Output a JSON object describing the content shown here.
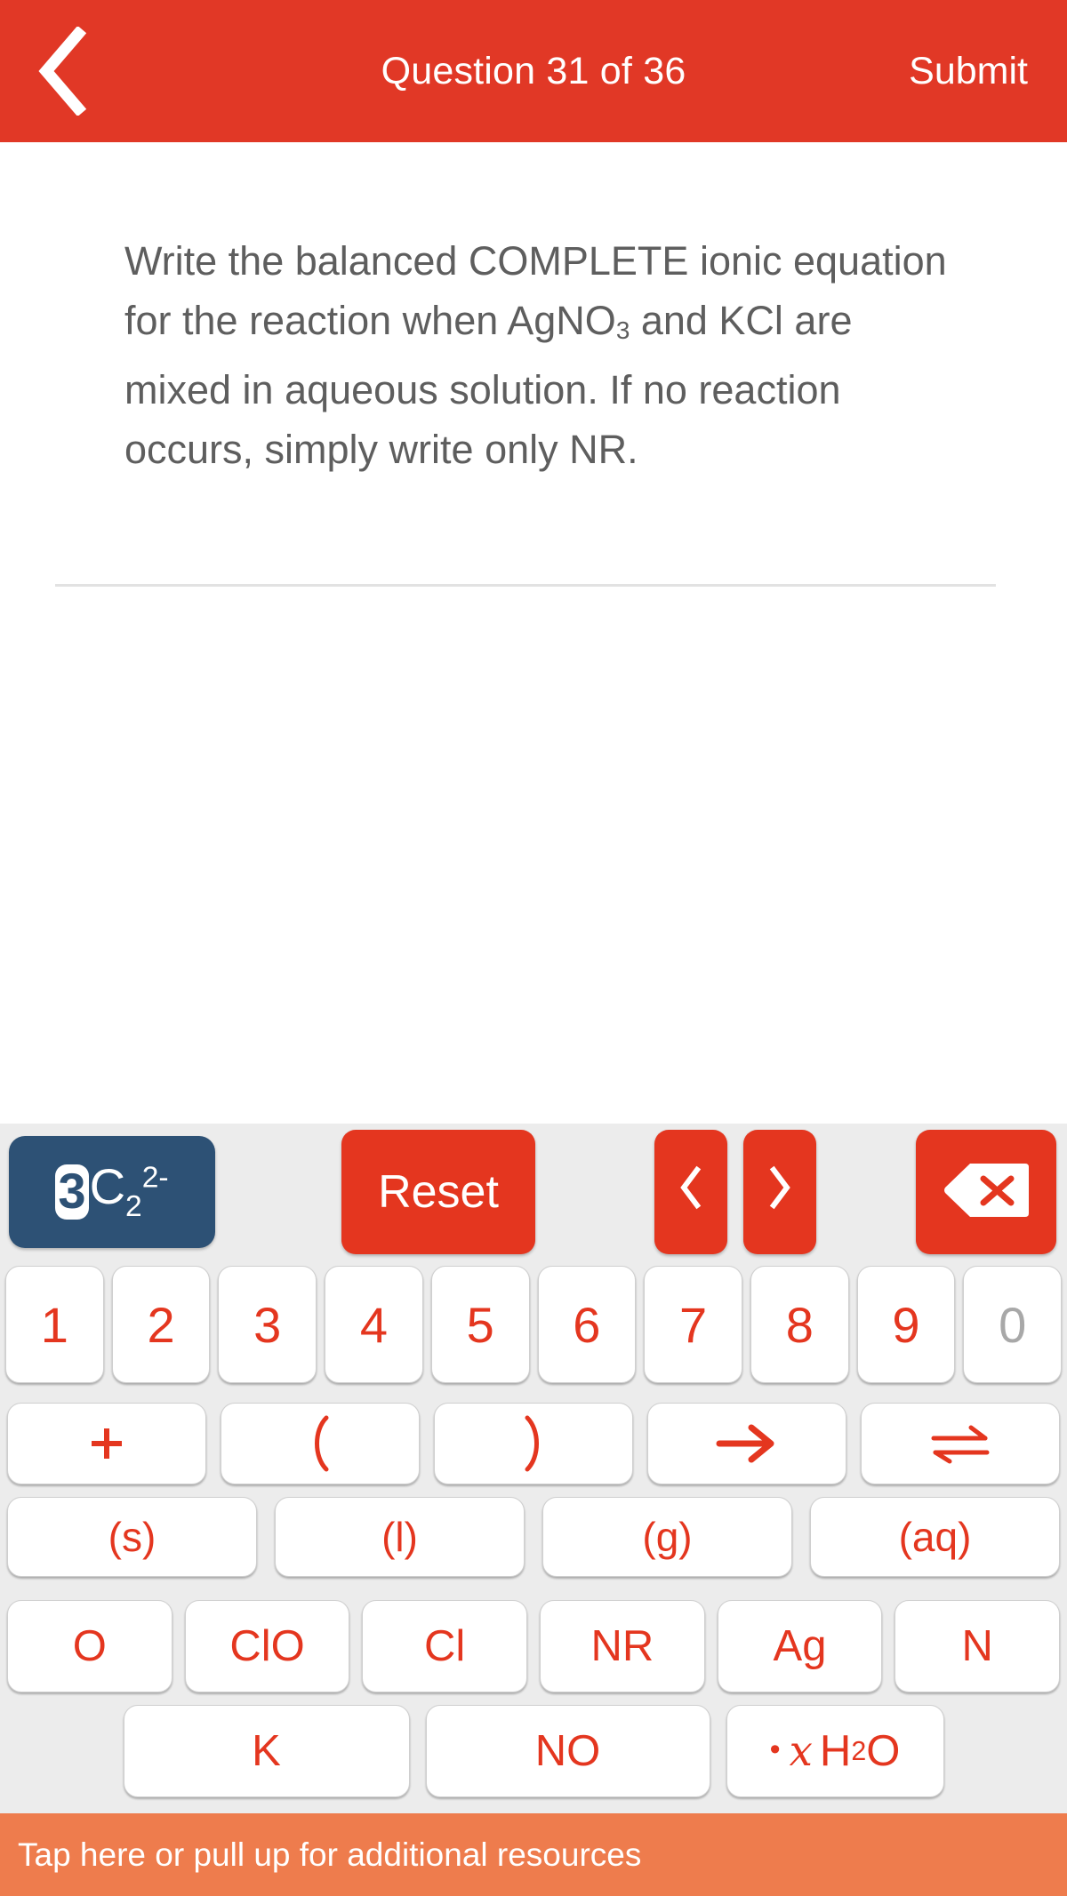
{
  "header": {
    "back_icon": "chevron-left-icon",
    "title": "Question 31 of 36",
    "submit_label": "Submit",
    "background_color": "#E13826"
  },
  "question": {
    "text_part_1": "Write the balanced COMPLETE ionic equation for the reaction when AgNO",
    "subscript_1": "3",
    "text_part_2": " and KCl are mixed in aqueous solution. If no reaction occurs, simply write only NR."
  },
  "answer": {
    "value": "",
    "placeholder": ""
  },
  "keyboard": {
    "badge": {
      "selected_token": "3",
      "formula_element": "C",
      "formula_subscript": "2",
      "formula_superscript": "2-",
      "background_color": "#2D5175"
    },
    "reset_label": "Reset",
    "prev_label": "‹",
    "next_label": "›",
    "backspace_icon": "backspace-delete-icon",
    "digits": [
      {
        "label": "1",
        "disabled": false
      },
      {
        "label": "2",
        "disabled": false
      },
      {
        "label": "3",
        "disabled": false
      },
      {
        "label": "4",
        "disabled": false
      },
      {
        "label": "5",
        "disabled": false
      },
      {
        "label": "6",
        "disabled": false
      },
      {
        "label": "7",
        "disabled": false
      },
      {
        "label": "8",
        "disabled": false
      },
      {
        "label": "9",
        "disabled": false
      },
      {
        "label": "0",
        "disabled": true
      }
    ],
    "operators": [
      {
        "label": "+",
        "icon": "plus-icon"
      },
      {
        "label": "(",
        "icon": "left-paren-icon"
      },
      {
        "label": ")",
        "icon": "right-paren-icon"
      },
      {
        "label": "→",
        "icon": "right-arrow-icon"
      },
      {
        "label": "⇌",
        "icon": "equilibrium-arrows-icon"
      }
    ],
    "states": [
      "(s)",
      "(l)",
      "(g)",
      "(aq)"
    ],
    "species": [
      "O",
      "ClO",
      "Cl",
      "NR",
      "Ag",
      "N"
    ],
    "last_row": {
      "k_label": "K",
      "no_label": "NO",
      "hydrate_dot": "•",
      "hydrate_x": "x",
      "hydrate_h": "H",
      "hydrate_sub": "2",
      "hydrate_o": "O"
    },
    "key_text_color": "#E4361F",
    "background_color": "#ECECEC"
  },
  "footer": {
    "label": "Tap here or pull up for additional resources",
    "background_color": "#EE7C4D"
  }
}
